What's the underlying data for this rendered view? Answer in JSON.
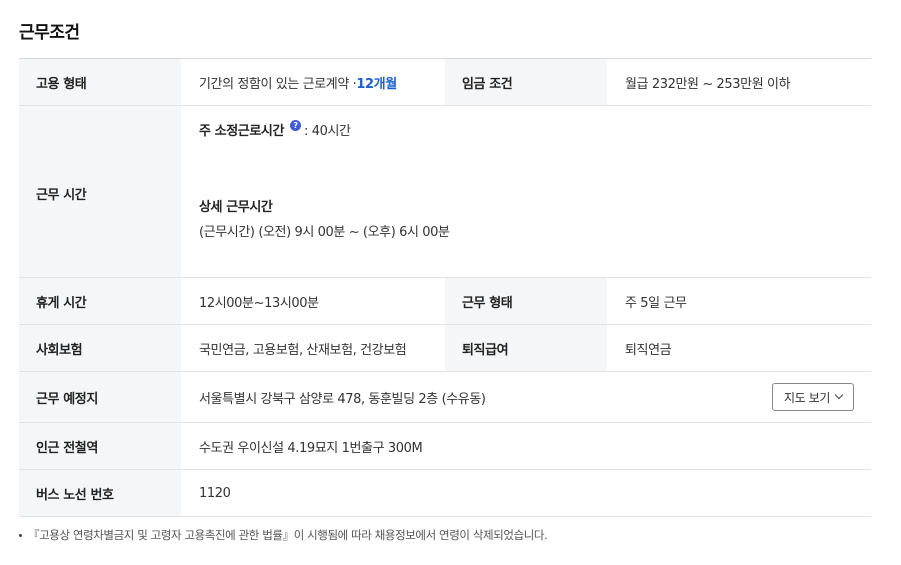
{
  "section_title": "근무조건",
  "rows": {
    "employment": {
      "label": "고용 형태",
      "value": "기간의 정함이 있는 근로계약 · ",
      "value_accent": "12개월",
      "label2": "임금 조건",
      "value2": "월급 232만원 ~ 253만원 이하"
    },
    "hours": {
      "label": "근무 시간",
      "weekly_label": "주 소정근로시간",
      "help_icon": "?",
      "weekly_value": ": 40시간",
      "detail_title": "상세 근무시간",
      "detail_value": "(근무시간) (오전) 9시 00분 ~ (오후) 6시 00분"
    },
    "break": {
      "label": "휴게 시간",
      "value": "12시00분~13시00분",
      "label2": "근무 형태",
      "value2": "주 5일 근무"
    },
    "insurance": {
      "label": "사회보험",
      "value": "국민연금, 고용보험, 산재보험, 건강보험",
      "label2": "퇴직급여",
      "value2": "퇴직연금"
    },
    "location": {
      "label": "근무 예정지",
      "value": "서울특별시 강북구 삼양로 478, 동훈빌딩 2층 (수유동)",
      "map_button": "지도 보기"
    },
    "station": {
      "label": "인근 전철역",
      "value": "수도권 우이신설 4.19묘지 1번출구 300M"
    },
    "bus": {
      "label": "버스 노선 번호",
      "value": "1120"
    }
  },
  "footnote": "『고용상 연령차별금지 및 고령자 고용촉진에 관한 법률』이 시행됨에 따라 채용정보에서 연령이 삭제되었습니다.",
  "colors": {
    "accent": "#1c5fd0",
    "header_bg": "#f5f6f7",
    "help_icon_bg": "#3f5bd6"
  }
}
